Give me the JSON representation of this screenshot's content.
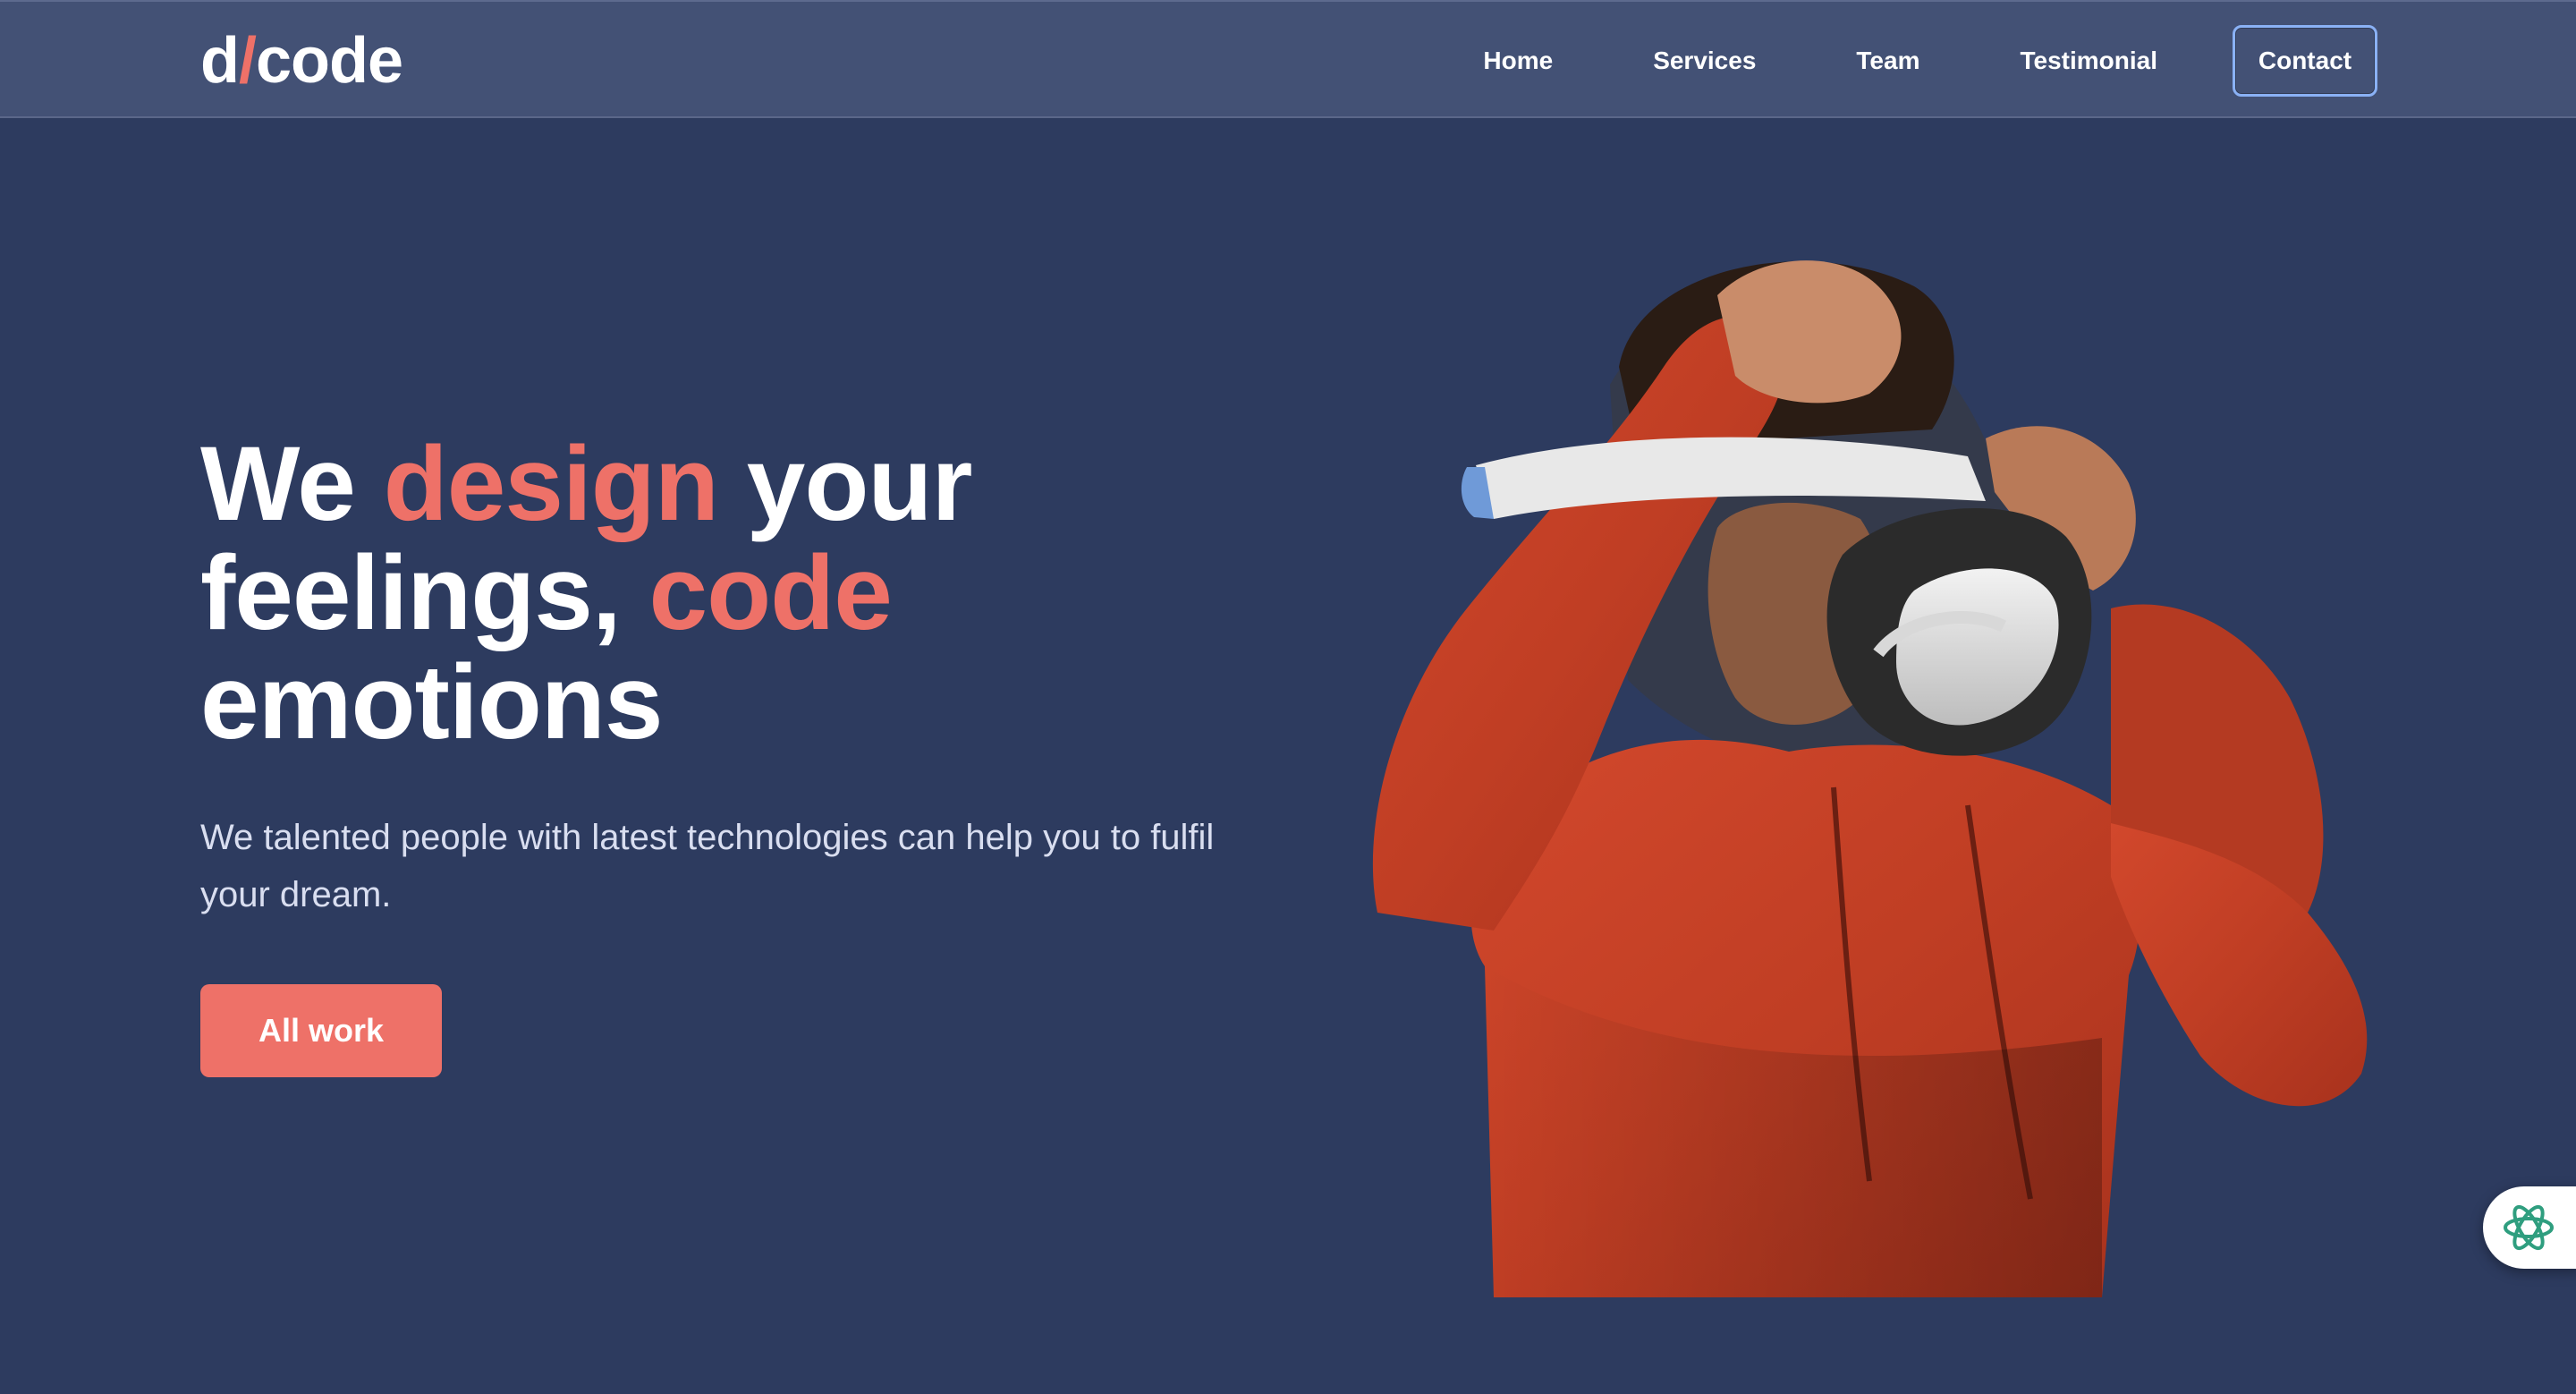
{
  "brand": {
    "logo_prefix": "d",
    "logo_slash": "/",
    "logo_suffix": "code",
    "accent_color": "#ee7168",
    "background_color": "#2d3b5f",
    "header_color": "#435175"
  },
  "nav": {
    "items": [
      {
        "label": "Home"
      },
      {
        "label": "Services"
      },
      {
        "label": "Team"
      },
      {
        "label": "Testimonial"
      }
    ],
    "contact_label": "Contact"
  },
  "hero": {
    "headline": {
      "part1": "We ",
      "accent1": "design",
      "part2": " your feelings, ",
      "accent2": "code",
      "part3": " emotions"
    },
    "subtext": "We talented people with latest technologies can help you to fulfil your dream.",
    "cta_label": "All work",
    "image_icon": "person-vr-headset-image"
  },
  "widget": {
    "icon": "ai-assistant-icon",
    "icon_color": "#2f9e7f"
  }
}
